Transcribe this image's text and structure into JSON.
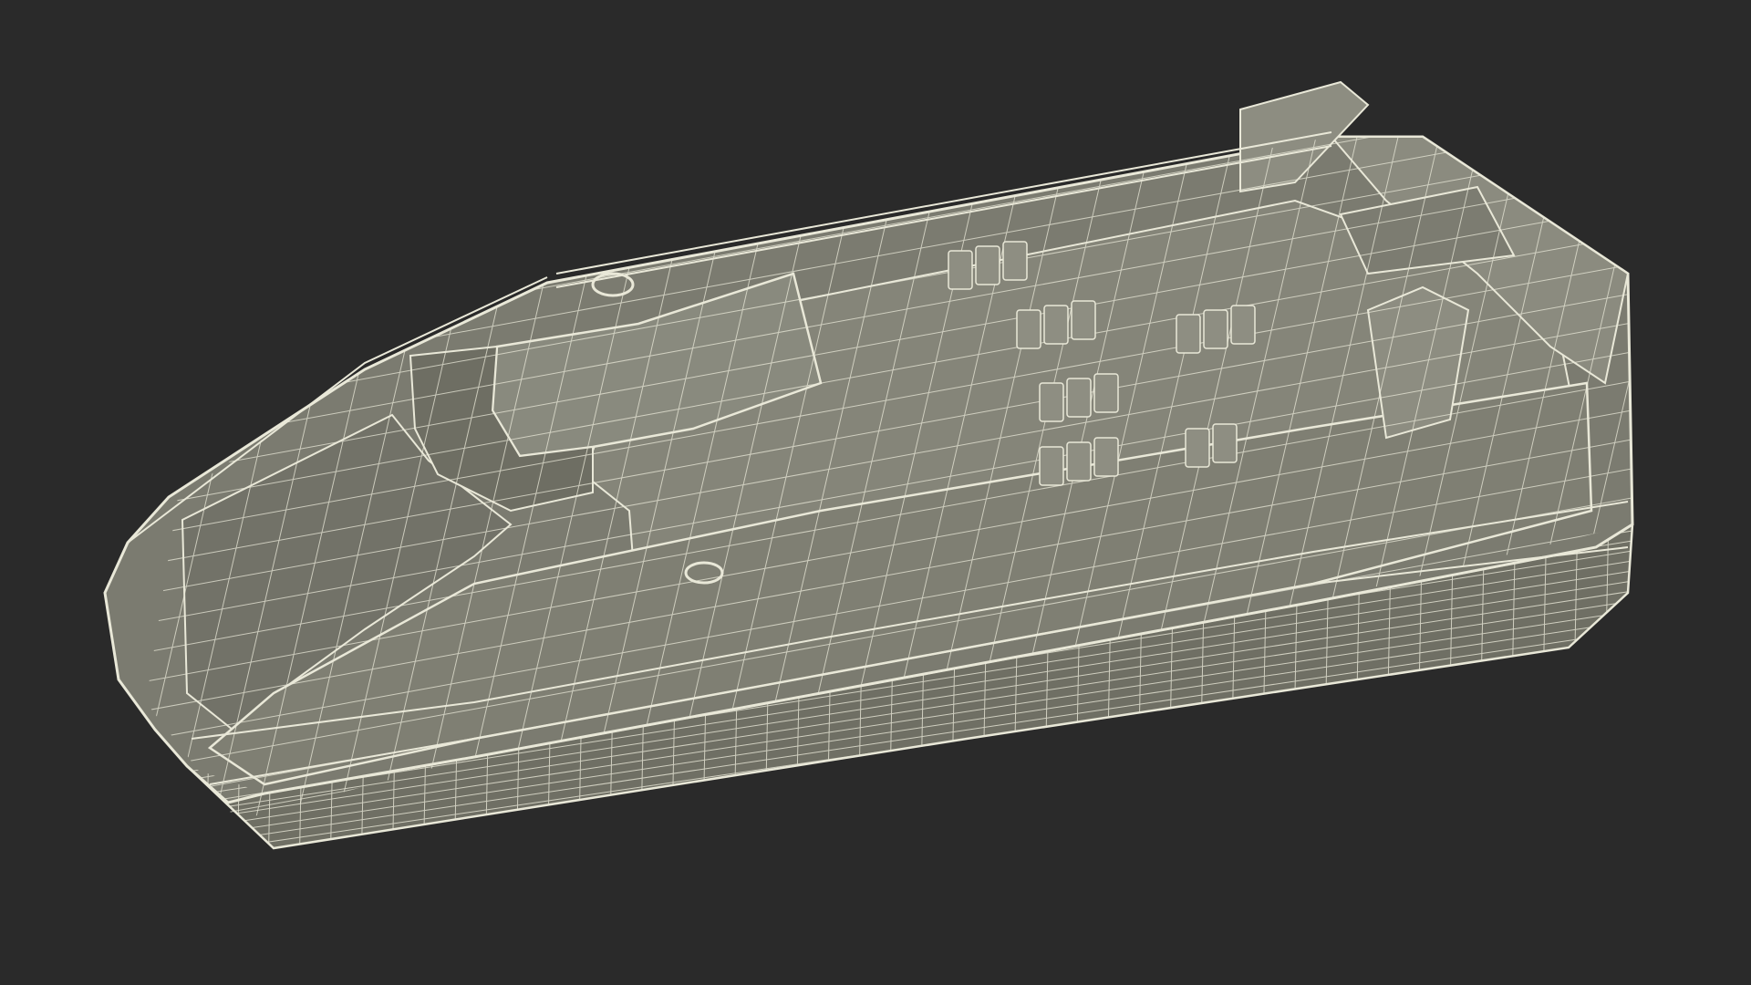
{
  "scene": {
    "subject": "catamaran-ferry-wireframe",
    "view": "perspective-top-three-quarter",
    "colors": {
      "background": "#2a2a2a",
      "surface": "#7b7b70",
      "surface_dark": "#67675c",
      "surface_light": "#8a8a7e",
      "wire": "#e9e8d8",
      "shadow": "#4a4a42"
    }
  }
}
